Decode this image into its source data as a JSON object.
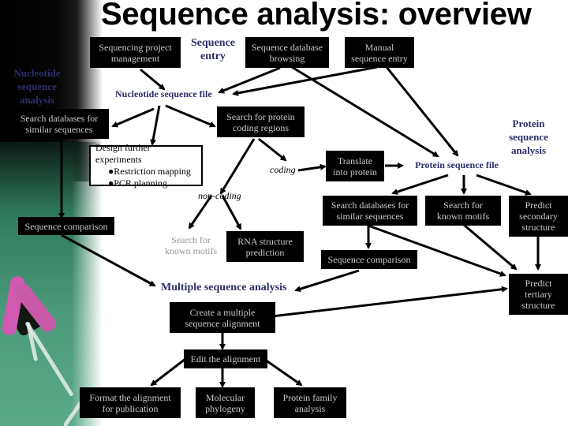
{
  "slide": {
    "title": "Sequence analysis: overview",
    "accent_color": "#2e2e6a",
    "box_color": "#000000"
  },
  "section_labels": {
    "nucleotide": "Nucleotide sequence analysis",
    "nucleotide_lines": [
      "Nucleotide",
      "sequence",
      "analysis"
    ],
    "protein_lines": [
      "Protein",
      "sequence",
      "analysis"
    ],
    "sequence_entry_lines": [
      "Sequence",
      "entry"
    ],
    "nucleotide_file": "Nucleotide sequence file",
    "protein_file": "Protein sequence file",
    "multiple": "Multiple sequence analysis"
  },
  "nodes": {
    "seq_project": [
      "Sequencing project",
      "management"
    ],
    "db_browsing": [
      "Sequence database",
      "browsing"
    ],
    "manual_entry": [
      "Manual",
      "sequence entry"
    ],
    "search_db_nuc": [
      "Search databases for",
      "similar sequences"
    ],
    "search_coding": [
      "Search for protein",
      "coding regions"
    ],
    "design_exp": {
      "heading": "Design further experiments",
      "bullets": [
        "●Restriction mapping",
        "●PCR planning"
      ]
    },
    "coding": "coding",
    "non_coding": "non-coding",
    "translate": [
      "Translate",
      "into protein"
    ],
    "seq_comparison_nuc": "Sequence comparison",
    "search_motifs_nuc": [
      "Search for",
      "known motifs"
    ],
    "rna_structure": [
      "RNA structure",
      "prediction"
    ],
    "search_db_prot": [
      "Search databases for",
      "similar sequences"
    ],
    "search_motifs_prot": [
      "Search for",
      "known motifs"
    ],
    "predict_secondary": [
      "Predict",
      "secondary",
      "structure"
    ],
    "seq_comparison_prot": "Sequence comparison",
    "predict_tertiary": [
      "Predict",
      "tertiary",
      "structure"
    ],
    "create_msa": [
      "Create a multiple",
      "sequence alignment"
    ],
    "edit_alignment": "Edit the alignment",
    "format_alignment": [
      "Format the alignment",
      "for publication"
    ],
    "phylogeny": [
      "Molecular",
      "phylogeny"
    ],
    "protein_family": [
      "Protein family",
      "analysis"
    ]
  }
}
